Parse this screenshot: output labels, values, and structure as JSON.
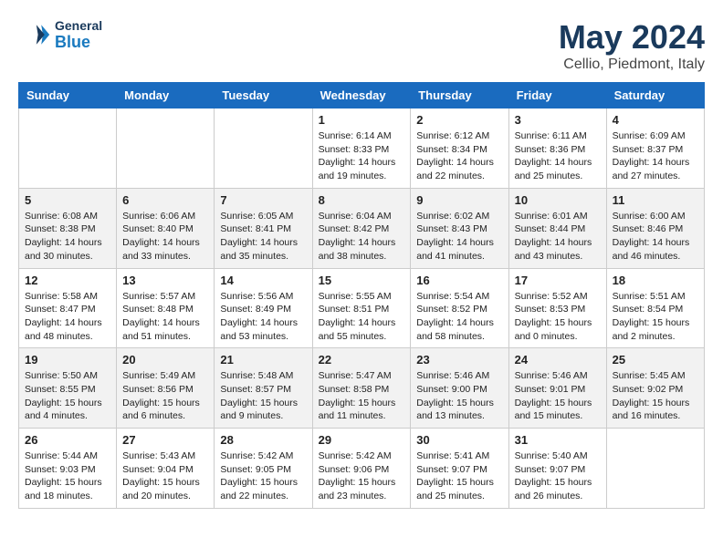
{
  "header": {
    "logo_general": "General",
    "logo_blue": "Blue",
    "month_year": "May 2024",
    "location": "Cellio, Piedmont, Italy"
  },
  "days_of_week": [
    "Sunday",
    "Monday",
    "Tuesday",
    "Wednesday",
    "Thursday",
    "Friday",
    "Saturday"
  ],
  "weeks": [
    [
      {
        "day": "",
        "content": ""
      },
      {
        "day": "",
        "content": ""
      },
      {
        "day": "",
        "content": ""
      },
      {
        "day": "1",
        "content": "Sunrise: 6:14 AM\nSunset: 8:33 PM\nDaylight: 14 hours\nand 19 minutes."
      },
      {
        "day": "2",
        "content": "Sunrise: 6:12 AM\nSunset: 8:34 PM\nDaylight: 14 hours\nand 22 minutes."
      },
      {
        "day": "3",
        "content": "Sunrise: 6:11 AM\nSunset: 8:36 PM\nDaylight: 14 hours\nand 25 minutes."
      },
      {
        "day": "4",
        "content": "Sunrise: 6:09 AM\nSunset: 8:37 PM\nDaylight: 14 hours\nand 27 minutes."
      }
    ],
    [
      {
        "day": "5",
        "content": "Sunrise: 6:08 AM\nSunset: 8:38 PM\nDaylight: 14 hours\nand 30 minutes."
      },
      {
        "day": "6",
        "content": "Sunrise: 6:06 AM\nSunset: 8:40 PM\nDaylight: 14 hours\nand 33 minutes."
      },
      {
        "day": "7",
        "content": "Sunrise: 6:05 AM\nSunset: 8:41 PM\nDaylight: 14 hours\nand 35 minutes."
      },
      {
        "day": "8",
        "content": "Sunrise: 6:04 AM\nSunset: 8:42 PM\nDaylight: 14 hours\nand 38 minutes."
      },
      {
        "day": "9",
        "content": "Sunrise: 6:02 AM\nSunset: 8:43 PM\nDaylight: 14 hours\nand 41 minutes."
      },
      {
        "day": "10",
        "content": "Sunrise: 6:01 AM\nSunset: 8:44 PM\nDaylight: 14 hours\nand 43 minutes."
      },
      {
        "day": "11",
        "content": "Sunrise: 6:00 AM\nSunset: 8:46 PM\nDaylight: 14 hours\nand 46 minutes."
      }
    ],
    [
      {
        "day": "12",
        "content": "Sunrise: 5:58 AM\nSunset: 8:47 PM\nDaylight: 14 hours\nand 48 minutes."
      },
      {
        "day": "13",
        "content": "Sunrise: 5:57 AM\nSunset: 8:48 PM\nDaylight: 14 hours\nand 51 minutes."
      },
      {
        "day": "14",
        "content": "Sunrise: 5:56 AM\nSunset: 8:49 PM\nDaylight: 14 hours\nand 53 minutes."
      },
      {
        "day": "15",
        "content": "Sunrise: 5:55 AM\nSunset: 8:51 PM\nDaylight: 14 hours\nand 55 minutes."
      },
      {
        "day": "16",
        "content": "Sunrise: 5:54 AM\nSunset: 8:52 PM\nDaylight: 14 hours\nand 58 minutes."
      },
      {
        "day": "17",
        "content": "Sunrise: 5:52 AM\nSunset: 8:53 PM\nDaylight: 15 hours\nand 0 minutes."
      },
      {
        "day": "18",
        "content": "Sunrise: 5:51 AM\nSunset: 8:54 PM\nDaylight: 15 hours\nand 2 minutes."
      }
    ],
    [
      {
        "day": "19",
        "content": "Sunrise: 5:50 AM\nSunset: 8:55 PM\nDaylight: 15 hours\nand 4 minutes."
      },
      {
        "day": "20",
        "content": "Sunrise: 5:49 AM\nSunset: 8:56 PM\nDaylight: 15 hours\nand 6 minutes."
      },
      {
        "day": "21",
        "content": "Sunrise: 5:48 AM\nSunset: 8:57 PM\nDaylight: 15 hours\nand 9 minutes."
      },
      {
        "day": "22",
        "content": "Sunrise: 5:47 AM\nSunset: 8:58 PM\nDaylight: 15 hours\nand 11 minutes."
      },
      {
        "day": "23",
        "content": "Sunrise: 5:46 AM\nSunset: 9:00 PM\nDaylight: 15 hours\nand 13 minutes."
      },
      {
        "day": "24",
        "content": "Sunrise: 5:46 AM\nSunset: 9:01 PM\nDaylight: 15 hours\nand 15 minutes."
      },
      {
        "day": "25",
        "content": "Sunrise: 5:45 AM\nSunset: 9:02 PM\nDaylight: 15 hours\nand 16 minutes."
      }
    ],
    [
      {
        "day": "26",
        "content": "Sunrise: 5:44 AM\nSunset: 9:03 PM\nDaylight: 15 hours\nand 18 minutes."
      },
      {
        "day": "27",
        "content": "Sunrise: 5:43 AM\nSunset: 9:04 PM\nDaylight: 15 hours\nand 20 minutes."
      },
      {
        "day": "28",
        "content": "Sunrise: 5:42 AM\nSunset: 9:05 PM\nDaylight: 15 hours\nand 22 minutes."
      },
      {
        "day": "29",
        "content": "Sunrise: 5:42 AM\nSunset: 9:06 PM\nDaylight: 15 hours\nand 23 minutes."
      },
      {
        "day": "30",
        "content": "Sunrise: 5:41 AM\nSunset: 9:07 PM\nDaylight: 15 hours\nand 25 minutes."
      },
      {
        "day": "31",
        "content": "Sunrise: 5:40 AM\nSunset: 9:07 PM\nDaylight: 15 hours\nand 26 minutes."
      },
      {
        "day": "",
        "content": ""
      }
    ]
  ]
}
